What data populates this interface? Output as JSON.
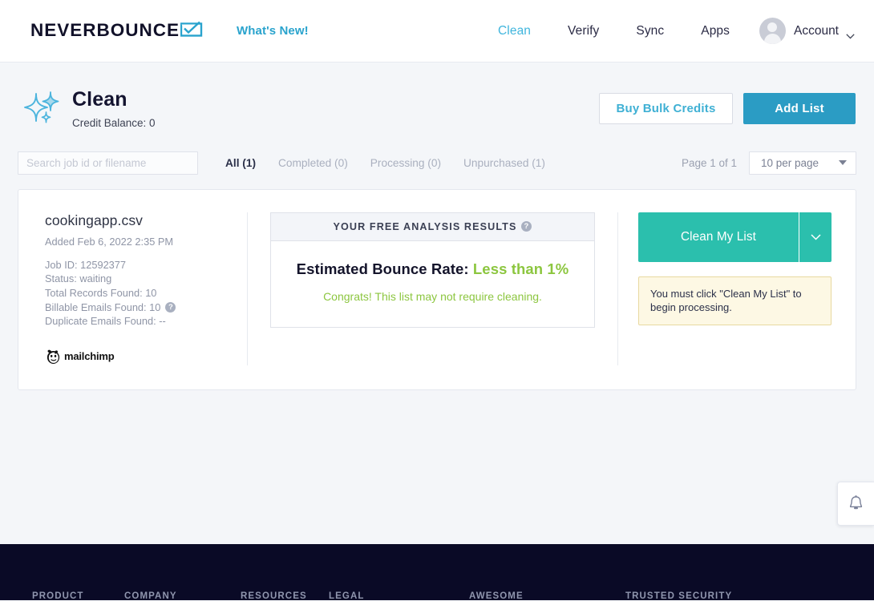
{
  "header": {
    "brand_name": "NEVERBOUNCE",
    "brand_mark_icon": "envelope-check-icon",
    "whats_new_label": "What's New!",
    "nav": [
      {
        "label": "Clean",
        "active": true
      },
      {
        "label": "Verify",
        "active": false
      },
      {
        "label": "Sync",
        "active": false
      },
      {
        "label": "Apps",
        "active": false
      }
    ],
    "account": {
      "label": "Account",
      "avatar_icon": "user-avatar-icon",
      "caret_icon": "chevron-down-icon"
    }
  },
  "page_header": {
    "icon": "sparkle-icon",
    "title": "Clean",
    "credit_balance": "Credit Balance: 0",
    "buy_bulk_credits_label": "Buy Bulk Credits",
    "add_list_label": "Add List"
  },
  "filters": {
    "search_placeholder": "Search job id or filename",
    "search_value": "",
    "tabs": [
      {
        "label": "All (1)",
        "active": true
      },
      {
        "label": "Completed (0)",
        "active": false
      },
      {
        "label": "Processing (0)",
        "active": false
      },
      {
        "label": "Unpurchased (1)",
        "active": false
      }
    ],
    "page_label": "Page 1 of 1",
    "per_page_value": "10 per page",
    "per_page_caret_icon": "caret-down-icon"
  },
  "job": {
    "file_name": "cookingapp.csv",
    "added": "Added Feb 6, 2022 2:35 PM",
    "job_id": "Job ID: 12592377",
    "status": "Status: waiting",
    "total_records": "Total Records Found: 10",
    "billable_emails": "Billable Emails Found: 10",
    "billable_help_icon": "question-mark-icon",
    "duplicate_emails": "Duplicate Emails Found: --",
    "integration_logo": "mailchimp-logo",
    "integration_name": "mailchimp",
    "analysis": {
      "header_title": "YOUR FREE ANALYSIS RESULTS",
      "header_help_icon": "question-mark-icon",
      "bounce_label": "Estimated Bounce Rate:",
      "bounce_value": "Less than 1%",
      "congrats": "Congrats! This list may not require cleaning."
    },
    "action": {
      "clean_button_label": "Clean My List",
      "clean_button_caret_icon": "chevron-down-icon",
      "notice": "You must click \"Clean My List\" to begin processing."
    }
  },
  "notify": {
    "icon": "bell-icon"
  },
  "footer": {
    "columns": [
      "PRODUCT",
      "COMPANY",
      "RESOURCES",
      "LEGAL",
      "AWESOME",
      "TRUSTED SECURITY"
    ]
  },
  "colors": {
    "brand_blue": "#29a3cd",
    "primary_button": "#2b9cc4",
    "accent_teal": "#2bbfad",
    "success_green": "#8cc63f",
    "notice_bg": "#fdf8e4",
    "footer_bg": "#0a0a26",
    "page_bg": "#f4f6f9"
  }
}
